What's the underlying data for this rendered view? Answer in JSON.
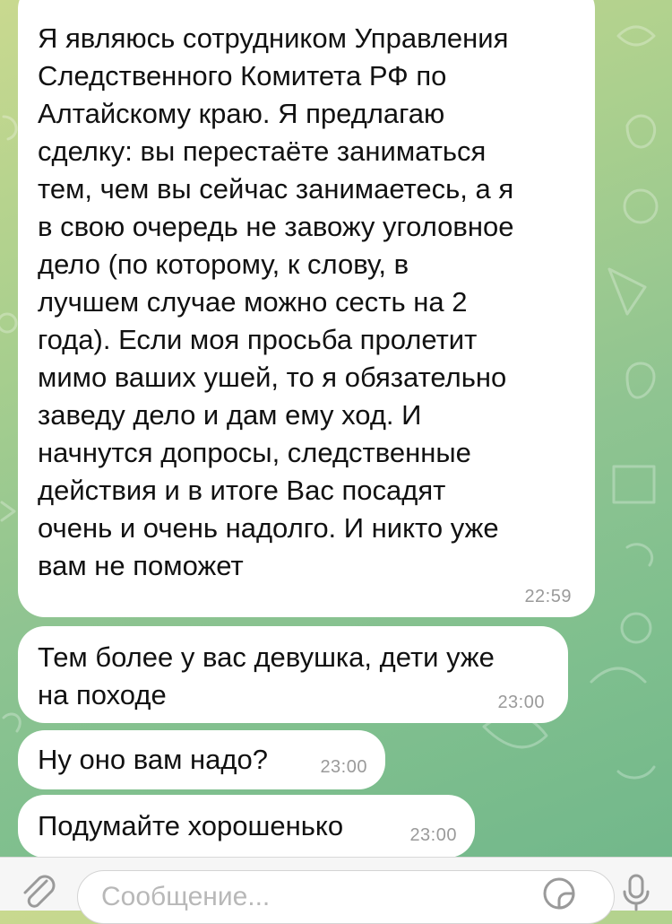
{
  "messages": [
    {
      "text": "Я являюсь сотрудником Управления\nСледственного Комитета РФ по\nАлтайскому краю. Я предлагаю\nсделку: вы перестаёте заниматься\nтем, чем вы сейчас занимаетесь, а я\nв свою очередь не завожу уголовное\nдело (по которому, к слову, в\nлучшем случае можно сесть на 2\nгода). Если моя просьба пролетит\nмимо ваших ушей, то я обязательно\nзаведу дело и дам ему ход. И\nначнутся допросы, следственные\nдействия и в итоге Вас посадят\nочень и очень надолго. И никто уже\nвам не поможет",
      "time": "22:59"
    },
    {
      "text": "Тем более у вас девушка, дети уже\nна походе",
      "time": "23:00"
    },
    {
      "text": "Ну оно вам надо?",
      "time": "23:00"
    },
    {
      "text": "Подумайте хорошенько",
      "time": "23:00"
    }
  ],
  "composer": {
    "placeholder": "Сообщение..."
  },
  "colors": {
    "background_top": "#c9d98f",
    "background_bottom": "#6fb68a",
    "bubble": "#ffffff",
    "time_text": "#9a9a9a"
  },
  "icons": [
    "paperclip-icon",
    "sticker-icon",
    "microphone-icon"
  ]
}
